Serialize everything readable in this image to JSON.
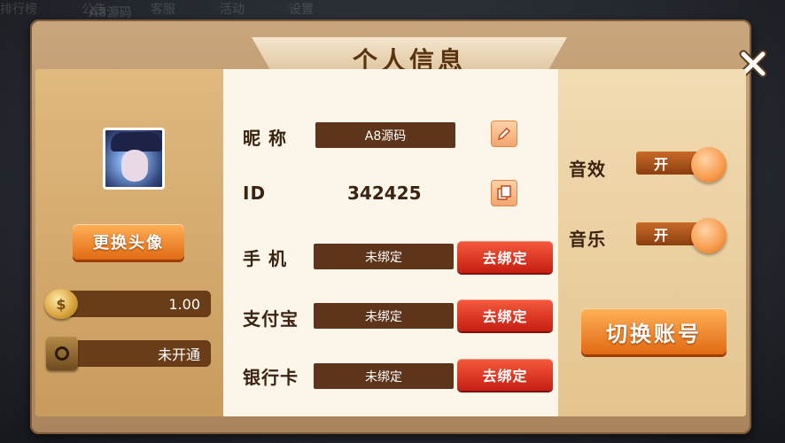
{
  "background": {
    "top_hint": "A8源码",
    "bottom_hints": [
      "排行榜",
      "公告",
      "客服",
      "活动",
      "设置"
    ]
  },
  "dialog": {
    "title": "个人信息",
    "close_icon": "close-x-icon"
  },
  "left": {
    "change_avatar_label": "更换头像",
    "gold_value": "1.00",
    "safe_value": "未开通",
    "coin_symbol": "$"
  },
  "center": {
    "nickname_label": "昵  称",
    "nickname_value": "A8源码",
    "id_label": "ID",
    "id_value": "342425",
    "phone_label": "手  机",
    "phone_value": "未绑定",
    "alipay_label": "支付宝",
    "alipay_value": "未绑定",
    "bank_label": "银行卡",
    "bank_value": "未绑定",
    "bind_label": "去绑定"
  },
  "right": {
    "sound_label": "音效",
    "sound_state": "开",
    "music_label": "音乐",
    "music_state": "开",
    "switch_account_label": "切换账号"
  },
  "colors": {
    "accent_orange": "#e06a14",
    "bind_red": "#c51e12",
    "field_brown": "#5e341a"
  }
}
